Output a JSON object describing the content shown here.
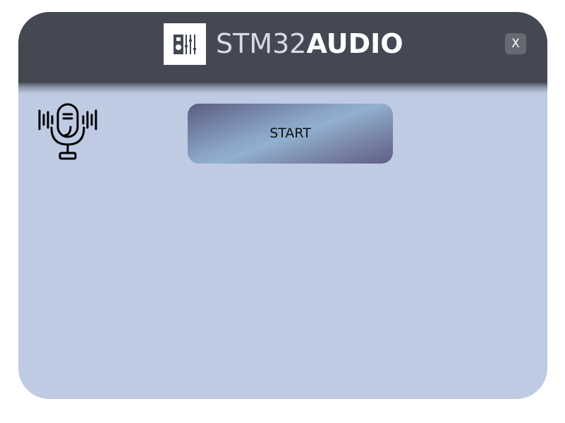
{
  "header": {
    "title_part1": "STM32",
    "title_part2": "AUDIO",
    "logo_icon": "audio-mixer-icon",
    "close_label": "X"
  },
  "main": {
    "mic_icon": "microphone-icon",
    "start_label": "START"
  },
  "colors": {
    "header_bg": "#444853",
    "body_bg": "#bfcbe3",
    "close_bg": "#666a73"
  }
}
